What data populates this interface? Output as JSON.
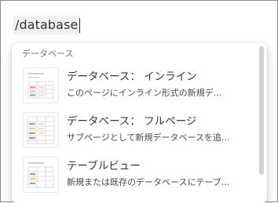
{
  "editor": {
    "command_text": "/database"
  },
  "menu": {
    "section_title": "データベース",
    "items": [
      {
        "title": "データベース： インライン",
        "description": "このページにインライン形式の新規デ...",
        "icon": "database-inline-icon"
      },
      {
        "title": "データベース： フルページ",
        "description": "サブページとして新規データベースを追...",
        "icon": "database-fullpage-icon"
      },
      {
        "title": "テーブルビュー",
        "description": "新規または既存のデータベースにテーブ...",
        "icon": "table-view-icon"
      }
    ]
  },
  "colors": {
    "tag_red": "#f07c7c",
    "tag_yellow": "#f5c85a",
    "tag_blue": "#6fa8dc",
    "text": "#37352f",
    "muted": "#787774"
  }
}
